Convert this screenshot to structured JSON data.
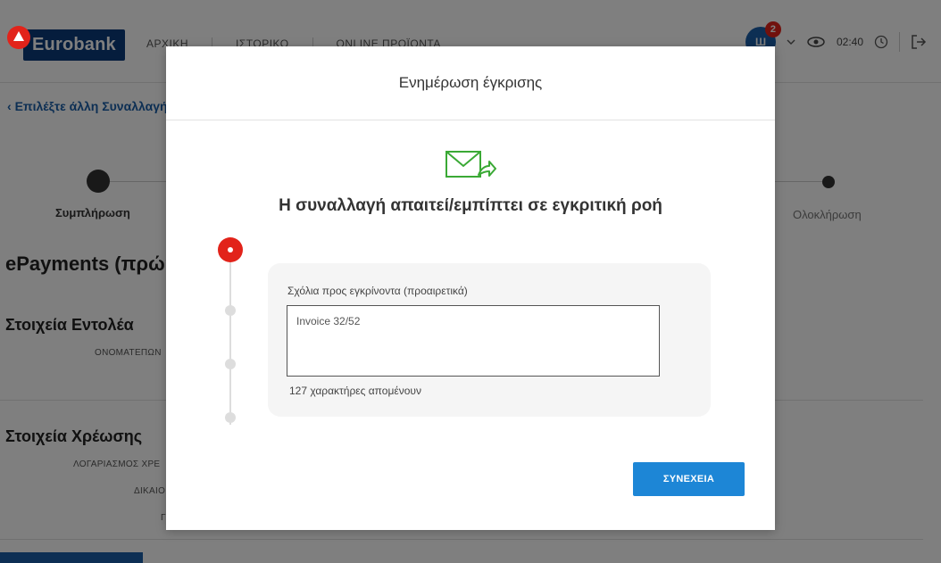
{
  "header": {
    "brand": "Eurobank",
    "nav": [
      "ΑΡΧΙΚΗ",
      "ΙΣΤΟΡΙΚΟ",
      "ONLINE ΠΡΟΪΟΝΤΑ"
    ],
    "avatar_initial": "Ш",
    "notification_count": "2",
    "session_time": "02:40"
  },
  "background": {
    "back_link": "Επιλέξτε άλλη Συναλλαγή",
    "steps": [
      "Συμπλήρωση",
      "Ολοκλήρωση"
    ],
    "page_title": "ePayments (πρώην",
    "section_sender": "Στοιχεία Εντολέα",
    "field_name": "ΟΝΟΜΑΤΕΠΩΝ",
    "section_debit": "Στοιχεία Χρέωσης",
    "field_account": "ΛΟΓΑΡΙΑΣΜΟΣ ΧΡΕ",
    "field_beneficiary": "ΔΙΚΑΙΟ",
    "field_other": "Γ"
  },
  "modal": {
    "title": "Ενημέρωση έγκρισης",
    "subtitle": "Η συναλλαγή απαιτεί/εμπίπτει σε εγκριτική ροή",
    "comment_label": "Σχόλια προς εγκρίνοντα (προαιρετικά)",
    "comment_value": "Invoice 32/52",
    "chars_left": "127 χαρακτήρες απομένουν",
    "continue_label": "ΣΥΝΕΧΕΙΑ"
  },
  "colors": {
    "brand_red": "#e2231a",
    "brand_blue": "#0a3a7a",
    "button_blue": "#1d86d6",
    "icon_green": "#3aa935"
  }
}
